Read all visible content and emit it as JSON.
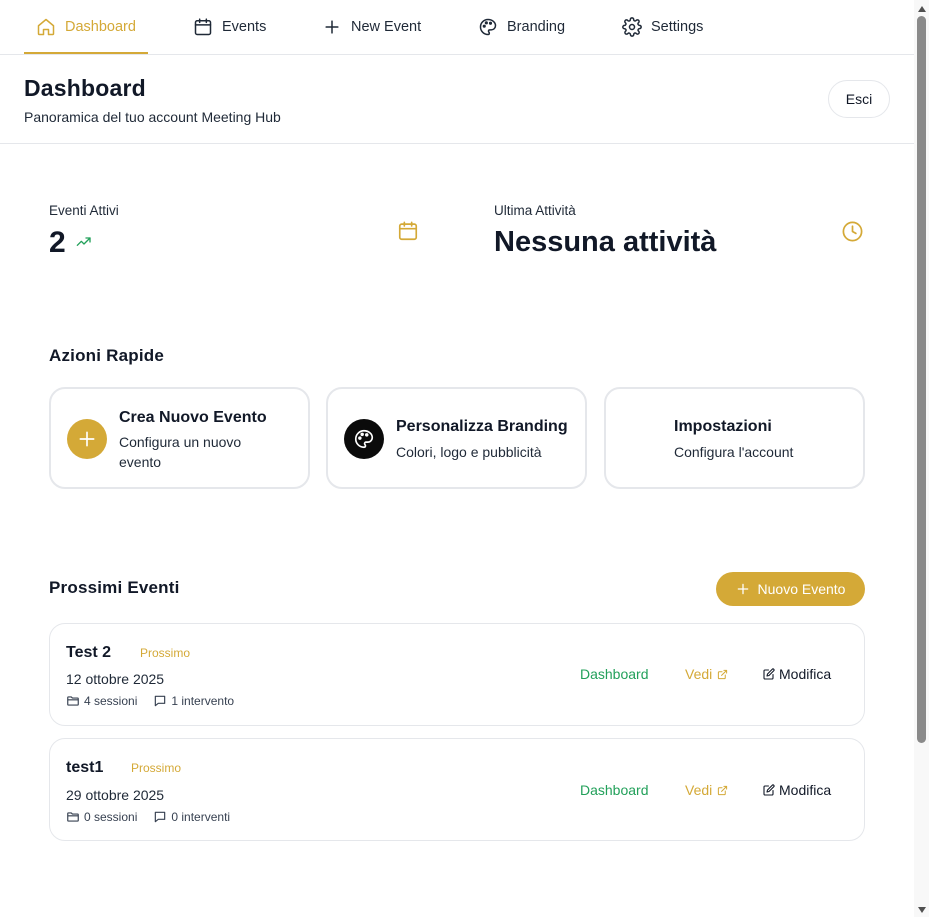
{
  "nav": {
    "items": [
      {
        "label": "Dashboard",
        "icon": "home-icon",
        "active": true
      },
      {
        "label": "Events",
        "icon": "calendar-icon",
        "active": false
      },
      {
        "label": "New Event",
        "icon": "plus-icon",
        "active": false
      },
      {
        "label": "Branding",
        "icon": "palette-icon",
        "active": false
      },
      {
        "label": "Settings",
        "icon": "gear-icon",
        "active": false
      }
    ]
  },
  "header": {
    "title": "Dashboard",
    "subtitle": "Panoramica del tuo account Meeting Hub",
    "logout_label": "Esci"
  },
  "stats": {
    "active_events": {
      "label": "Eventi Attivi",
      "value": "2",
      "trend_icon": "trending-up-icon",
      "icon": "calendar-icon"
    },
    "last_activity": {
      "label": "Ultima Attività",
      "value": "Nessuna attività",
      "icon": "clock-icon"
    }
  },
  "quick_actions": {
    "title": "Azioni Rapide",
    "items": [
      {
        "title": "Crea Nuovo Evento",
        "desc": "Configura un nuovo evento",
        "icon": "plus-icon"
      },
      {
        "title": "Personalizza Branding",
        "desc": "Colori, logo e pubblicità",
        "icon": "palette-icon"
      },
      {
        "title": "Impostazioni",
        "desc": "Configura l'account",
        "icon": "gear-icon"
      }
    ]
  },
  "upcoming": {
    "title": "Prossimi Eventi",
    "new_button_label": "Nuovo Evento",
    "events": [
      {
        "name": "Test 2",
        "status": "Prossimo",
        "date": "12 ottobre 2025",
        "sessions": "4 sessioni",
        "talks": "1 intervento",
        "dashboard_label": "Dashboard",
        "view_label": "Vedi",
        "edit_label": "Modifica"
      },
      {
        "name": "test1",
        "status": "Prossimo",
        "date": "29 ottobre 2025",
        "sessions": "0 sessioni",
        "talks": "0 interventi",
        "dashboard_label": "Dashboard",
        "view_label": "Vedi",
        "edit_label": "Modifica"
      }
    ]
  },
  "colors": {
    "accent": "#d4a937",
    "success": "#22a05a",
    "text": "#111827",
    "border": "#e5e7eb"
  }
}
